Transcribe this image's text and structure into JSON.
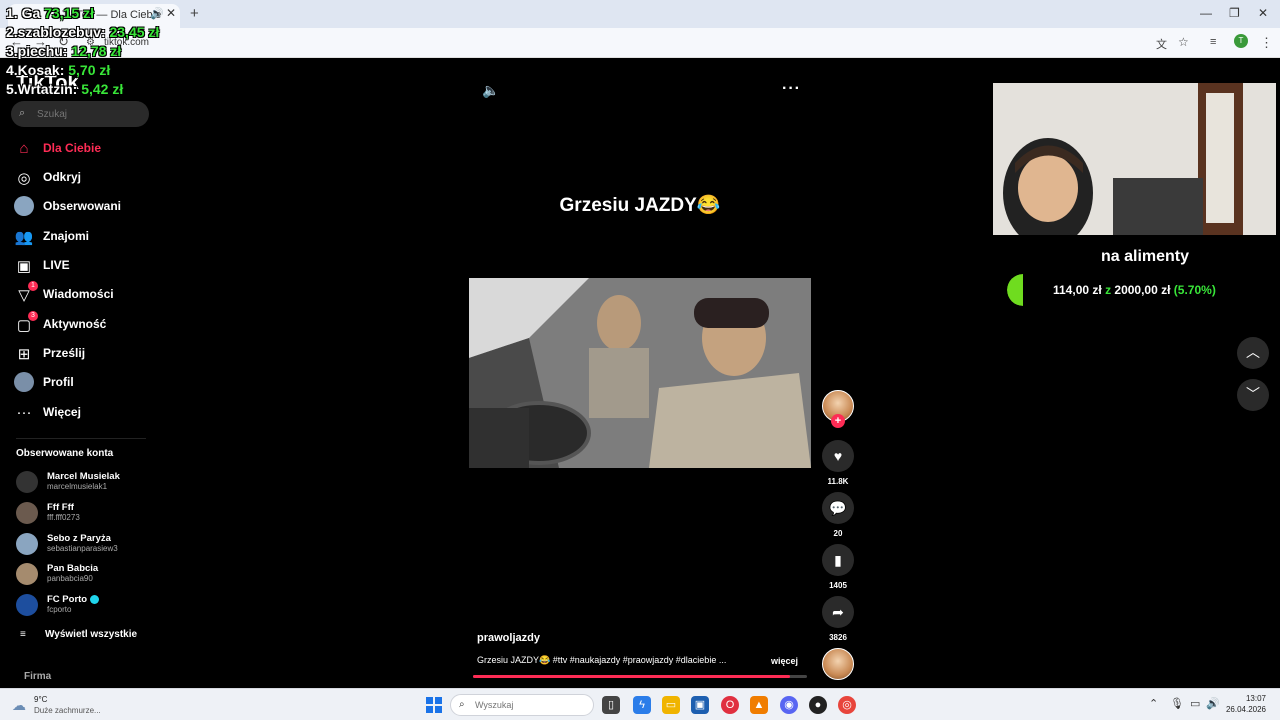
{
  "browser": {
    "tab_title": "TikTok — Dla Ciebie",
    "url": "tiktok.com",
    "profile_initial": "T"
  },
  "leaderboard": [
    {
      "label": "1. Ga",
      "amount": "73,15 zł"
    },
    {
      "label": "2.szablozebuv:",
      "amount": "23,45 zł"
    },
    {
      "label": "3.piechu:",
      "amount": "12,78 zł"
    },
    {
      "label": "4.Kosak:",
      "amount": "5,70 zł"
    },
    {
      "label": "5.Wrtatzin:",
      "amount": "5,42 zł"
    }
  ],
  "logo": "TikTok",
  "search": {
    "placeholder": "Szukaj"
  },
  "nav": {
    "for_you": "Dla Ciebie",
    "explore": "Odkryj",
    "following": "Obserwowani",
    "friends": "Znajomi",
    "live": "LIVE",
    "messages": "Wiadomości",
    "messages_badge": "1",
    "activity": "Aktywność",
    "activity_badge": "3",
    "upload": "Prześlij",
    "profile": "Profil",
    "more": "Więcej"
  },
  "followed": {
    "title": "Obserwowane konta",
    "accounts": [
      {
        "name": "Marcel Musielak",
        "handle": "marcelmusielak1"
      },
      {
        "name": "Fff Fff",
        "handle": "fff.fff0273"
      },
      {
        "name": "Sebo z Paryża",
        "handle": "sebastianparasiew3"
      },
      {
        "name": "Pan Babcia",
        "handle": "panbabcia90"
      },
      {
        "name": "FC Porto",
        "handle": "fcporto"
      }
    ],
    "show_all": "Wyświetl wszystkie"
  },
  "footer_label": "Firma",
  "video": {
    "title": "Grzesiu JAZDY😂",
    "author": "prawoljazdy",
    "caption": "Grzesiu JAZDY😂 #ttv #naukajazdy #praowjazdy #dlaciebie ...",
    "more": "więcej",
    "progress": 0.95,
    "likes": "11.8K",
    "comments": "20",
    "saves": "1405",
    "shares": "3826"
  },
  "goal": {
    "title": "na alimenty",
    "current": "114,00 zł",
    "separator": "z",
    "target": "2000,00 zł",
    "percent": "(5.70%)",
    "fraction": 0.057
  },
  "taskbar": {
    "weather_temp": "9°C",
    "weather_desc": "Duże zachmurze...",
    "search_placeholder": "Wyszukaj",
    "time": "13:07",
    "date": "26.04.2026"
  },
  "colors": {
    "accent": "#fe2c55",
    "goal_green": "#39e639"
  }
}
